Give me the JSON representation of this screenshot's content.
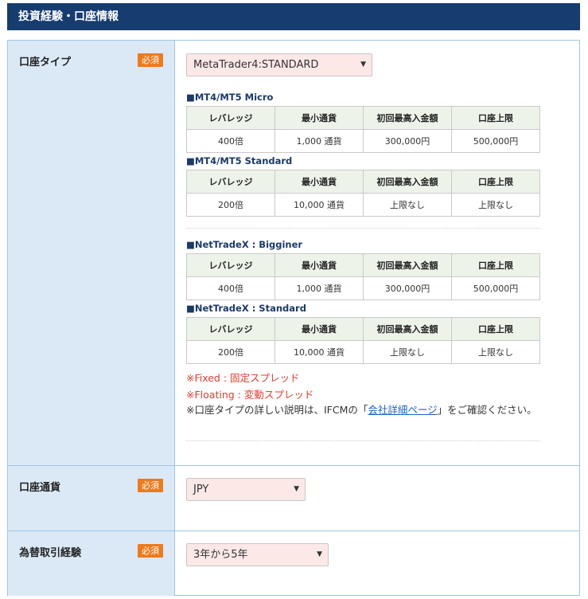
{
  "section": {
    "title": "投資経験・口座情報"
  },
  "required_badge": "必須",
  "account_type": {
    "label": "口座タイプ",
    "selected": "MetaTrader4:STANDARD",
    "tables": [
      {
        "title": "■MT4/MT5 Micro",
        "headers": [
          "レバレッジ",
          "最小通貨",
          "初回最高入金額",
          "口座上限"
        ],
        "row": [
          "400倍",
          "1,000 通貨",
          "300,000円",
          "500,000円"
        ]
      },
      {
        "title": "■MT4/MT5 Standard",
        "headers": [
          "レバレッジ",
          "最小通貨",
          "初回最高入金額",
          "口座上限"
        ],
        "row": [
          "200倍",
          "10,000 通貨",
          "上限なし",
          "上限なし"
        ]
      },
      {
        "title": "■NetTradeX : Bigginer",
        "headers": [
          "レバレッジ",
          "最小通貨",
          "初回最高入金額",
          "口座上限"
        ],
        "row": [
          "400倍",
          "1,000 通貨",
          "300,000円",
          "500,000円"
        ]
      },
      {
        "title": "■NetTradeX : Standard",
        "headers": [
          "レバレッジ",
          "最小通貨",
          "初回最高入金額",
          "口座上限"
        ],
        "row": [
          "200倍",
          "10,000 通貨",
          "上限なし",
          "上限なし"
        ]
      }
    ],
    "note_fixed": "※Fixed : 固定スプレッド",
    "note_floating": "※Floating : 変動スプレッド",
    "note_pre": "※口座タイプの詳しい説明は、IFCMの「",
    "note_link": "会社詳細ページ",
    "note_post": "」をご確認ください。"
  },
  "currency": {
    "label": "口座通貨",
    "selected": "JPY"
  },
  "fx_experience": {
    "label": "為替取引経験",
    "selected": "3年から5年"
  },
  "caret_glyph": "▼"
}
